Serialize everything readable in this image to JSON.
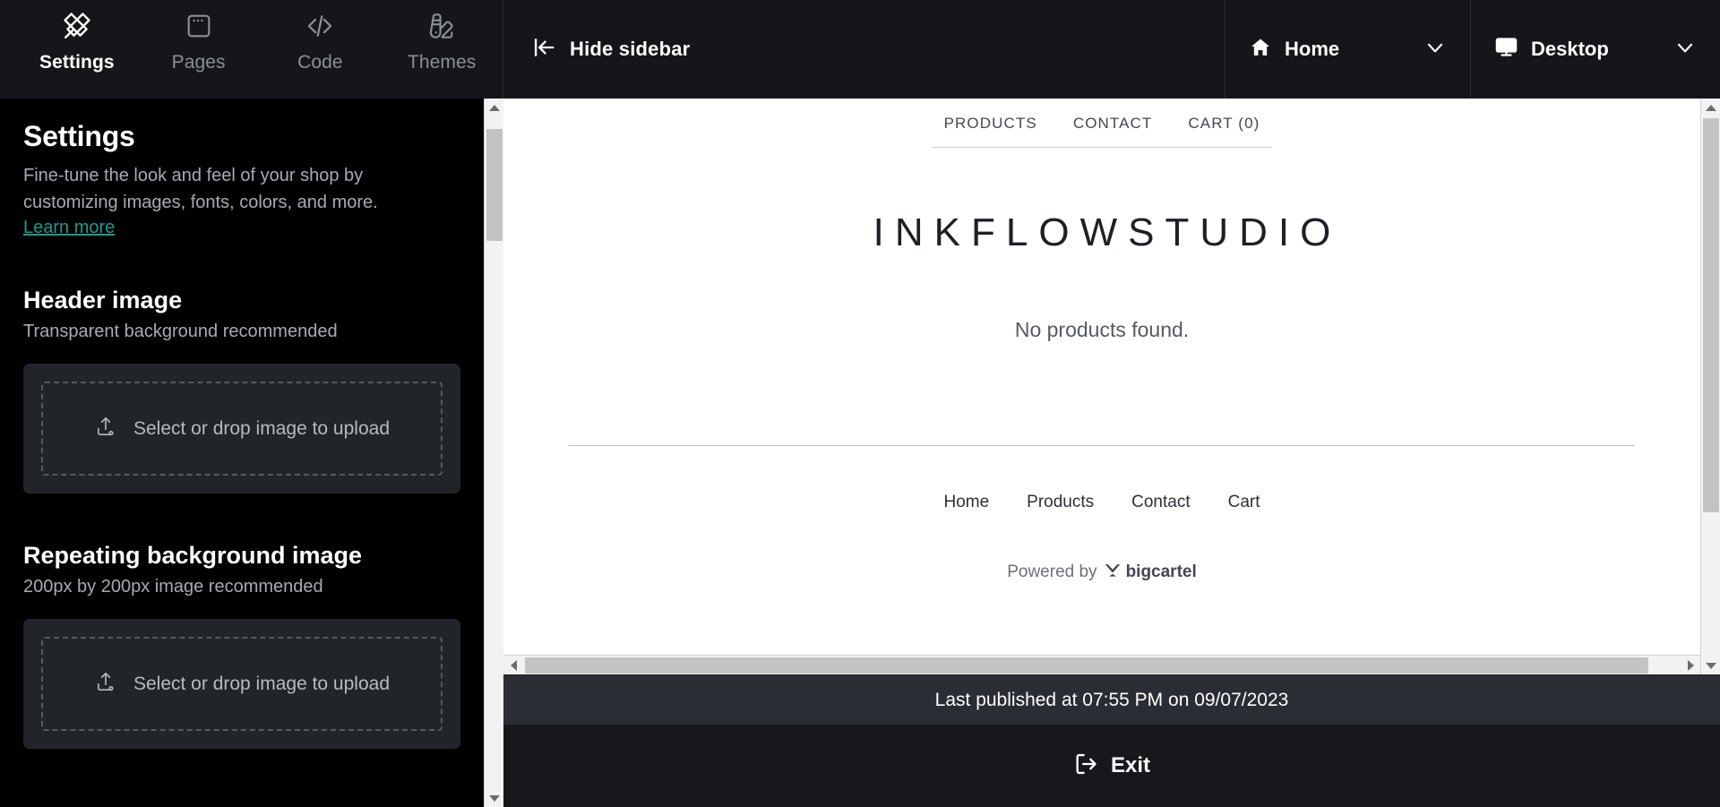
{
  "topbar": {
    "tools": [
      {
        "label": "Settings",
        "icon": "design-tools-icon",
        "active": true
      },
      {
        "label": "Pages",
        "icon": "browser-window-icon",
        "active": false
      },
      {
        "label": "Code",
        "icon": "code-brackets-icon",
        "active": false
      },
      {
        "label": "Themes",
        "icon": "color-swatch-icon",
        "active": false
      }
    ],
    "hide_sidebar_label": "Hide sidebar",
    "page_select": {
      "label": "Home",
      "icon": "home-icon",
      "chevron": "chevron-down-icon"
    },
    "device_select": {
      "label": "Desktop",
      "icon": "monitor-icon",
      "chevron": "chevron-down-icon"
    }
  },
  "sidebar": {
    "title": "Settings",
    "description": "Fine-tune the look and feel of your shop by customizing images, fonts, colors, and more.",
    "learn_more": "Learn more",
    "learn_more_color": "#1f9b8e",
    "sections": [
      {
        "title": "Header image",
        "subtitle": "Transparent background recommended",
        "upload_label": "Select or drop image to upload",
        "upload_icon": "upload-icon"
      },
      {
        "title": "Repeating background image",
        "subtitle": "200px by 200px image recommended",
        "upload_label": "Select or drop image to upload",
        "upload_icon": "upload-icon"
      }
    ]
  },
  "preview": {
    "nav": [
      "PRODUCTS",
      "CONTACT",
      "CART (0)"
    ],
    "store_title": "INKFLOWSTUDIO",
    "empty_message": "No products found.",
    "footer_nav": [
      "Home",
      "Products",
      "Contact",
      "Cart"
    ],
    "powered_by_prefix": "Powered by",
    "powered_by_brand": "bigcartel"
  },
  "footer": {
    "last_published": "Last published at 07:55 PM on 09/07/2023",
    "exit_label": "Exit",
    "exit_icon": "logout-icon"
  }
}
